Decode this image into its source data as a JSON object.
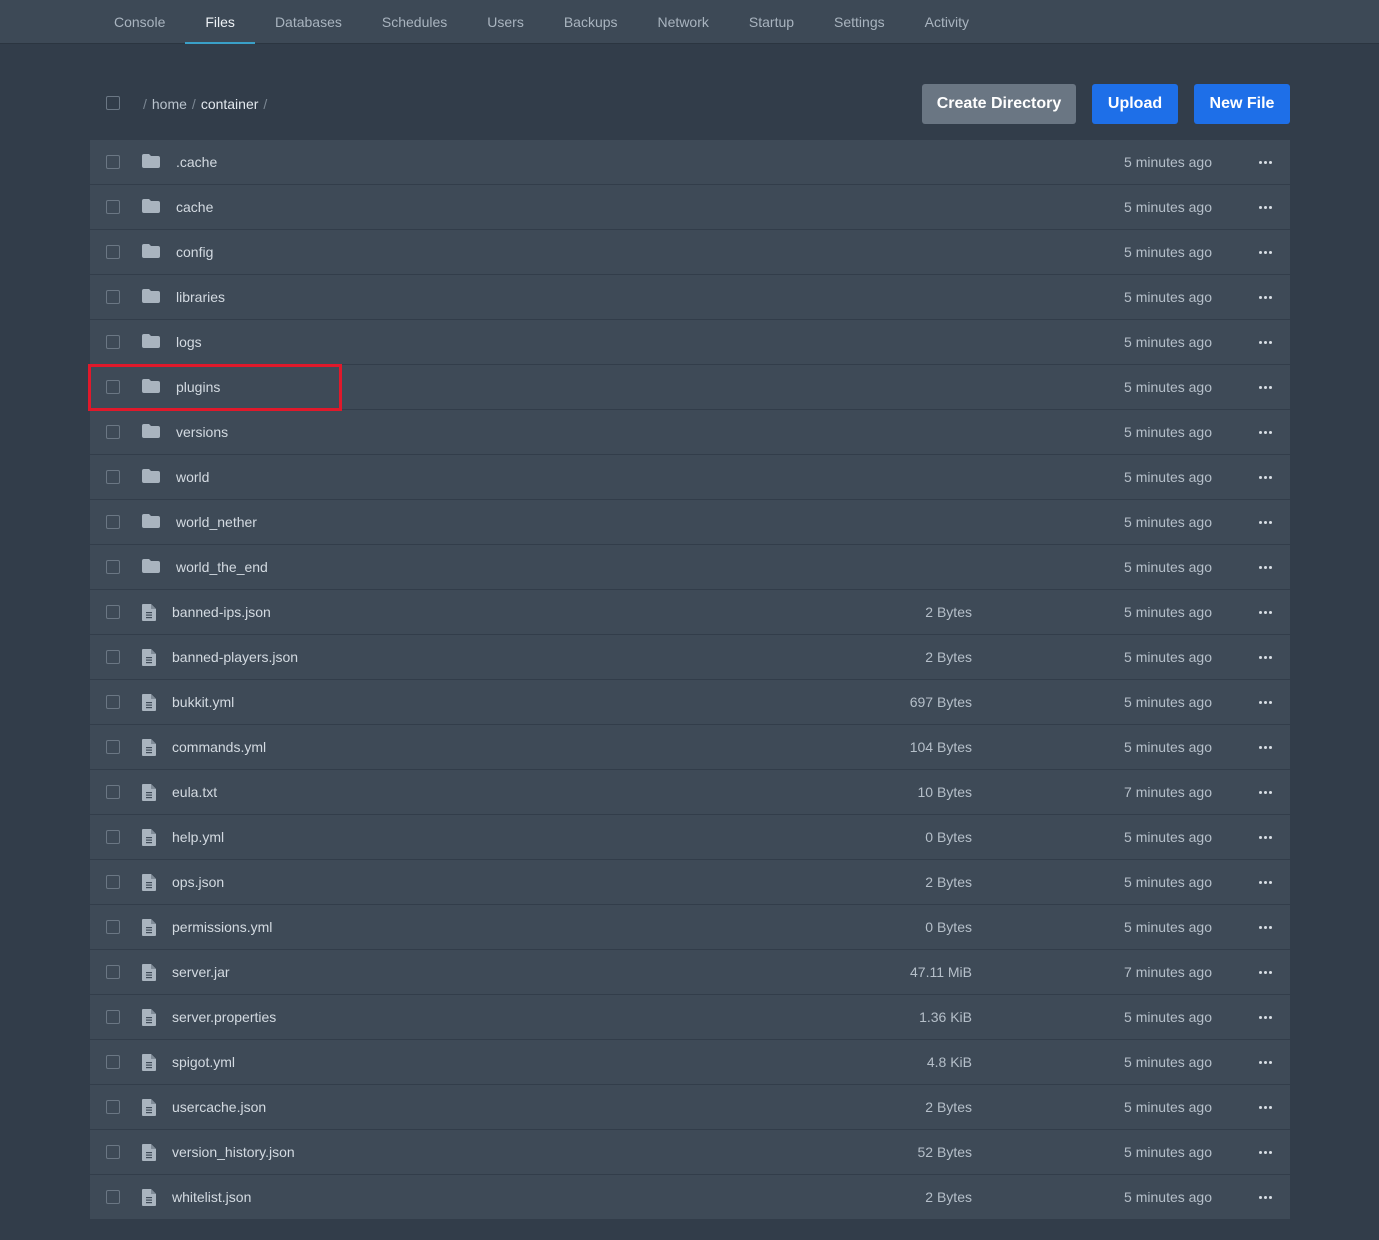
{
  "nav": {
    "tabs": [
      {
        "label": "Console"
      },
      {
        "label": "Files"
      },
      {
        "label": "Databases"
      },
      {
        "label": "Schedules"
      },
      {
        "label": "Users"
      },
      {
        "label": "Backups"
      },
      {
        "label": "Network"
      },
      {
        "label": "Startup"
      },
      {
        "label": "Settings"
      },
      {
        "label": "Activity"
      }
    ],
    "active_tab": "Files"
  },
  "breadcrumb": {
    "sep": "/",
    "home": "home",
    "current": "container"
  },
  "buttons": {
    "create_directory": "Create Directory",
    "upload": "Upload",
    "new_file": "New File"
  },
  "colors": {
    "accent_blue": "#1e6fe8",
    "highlight_red": "#e0192b",
    "active_tab_underline": "#3aa0c8"
  },
  "files": [
    {
      "name": ".cache",
      "type": "folder",
      "size": "",
      "modified": "5 minutes ago"
    },
    {
      "name": "cache",
      "type": "folder",
      "size": "",
      "modified": "5 minutes ago"
    },
    {
      "name": "config",
      "type": "folder",
      "size": "",
      "modified": "5 minutes ago"
    },
    {
      "name": "libraries",
      "type": "folder",
      "size": "",
      "modified": "5 minutes ago"
    },
    {
      "name": "logs",
      "type": "folder",
      "size": "",
      "modified": "5 minutes ago"
    },
    {
      "name": "plugins",
      "type": "folder",
      "size": "",
      "modified": "5 minutes ago",
      "highlighted": true
    },
    {
      "name": "versions",
      "type": "folder",
      "size": "",
      "modified": "5 minutes ago"
    },
    {
      "name": "world",
      "type": "folder",
      "size": "",
      "modified": "5 minutes ago"
    },
    {
      "name": "world_nether",
      "type": "folder",
      "size": "",
      "modified": "5 minutes ago"
    },
    {
      "name": "world_the_end",
      "type": "folder",
      "size": "",
      "modified": "5 minutes ago"
    },
    {
      "name": "banned-ips.json",
      "type": "file",
      "size": "2 Bytes",
      "modified": "5 minutes ago"
    },
    {
      "name": "banned-players.json",
      "type": "file",
      "size": "2 Bytes",
      "modified": "5 minutes ago"
    },
    {
      "name": "bukkit.yml",
      "type": "file",
      "size": "697 Bytes",
      "modified": "5 minutes ago"
    },
    {
      "name": "commands.yml",
      "type": "file",
      "size": "104 Bytes",
      "modified": "5 minutes ago"
    },
    {
      "name": "eula.txt",
      "type": "file",
      "size": "10 Bytes",
      "modified": "7 minutes ago"
    },
    {
      "name": "help.yml",
      "type": "file",
      "size": "0 Bytes",
      "modified": "5 minutes ago"
    },
    {
      "name": "ops.json",
      "type": "file",
      "size": "2 Bytes",
      "modified": "5 minutes ago"
    },
    {
      "name": "permissions.yml",
      "type": "file",
      "size": "0 Bytes",
      "modified": "5 minutes ago"
    },
    {
      "name": "server.jar",
      "type": "file",
      "size": "47.11 MiB",
      "modified": "7 minutes ago"
    },
    {
      "name": "server.properties",
      "type": "file",
      "size": "1.36 KiB",
      "modified": "5 minutes ago"
    },
    {
      "name": "spigot.yml",
      "type": "file",
      "size": "4.8 KiB",
      "modified": "5 minutes ago"
    },
    {
      "name": "usercache.json",
      "type": "file",
      "size": "2 Bytes",
      "modified": "5 minutes ago"
    },
    {
      "name": "version_history.json",
      "type": "file",
      "size": "52 Bytes",
      "modified": "5 minutes ago"
    },
    {
      "name": "whitelist.json",
      "type": "file",
      "size": "2 Bytes",
      "modified": "5 minutes ago"
    }
  ]
}
